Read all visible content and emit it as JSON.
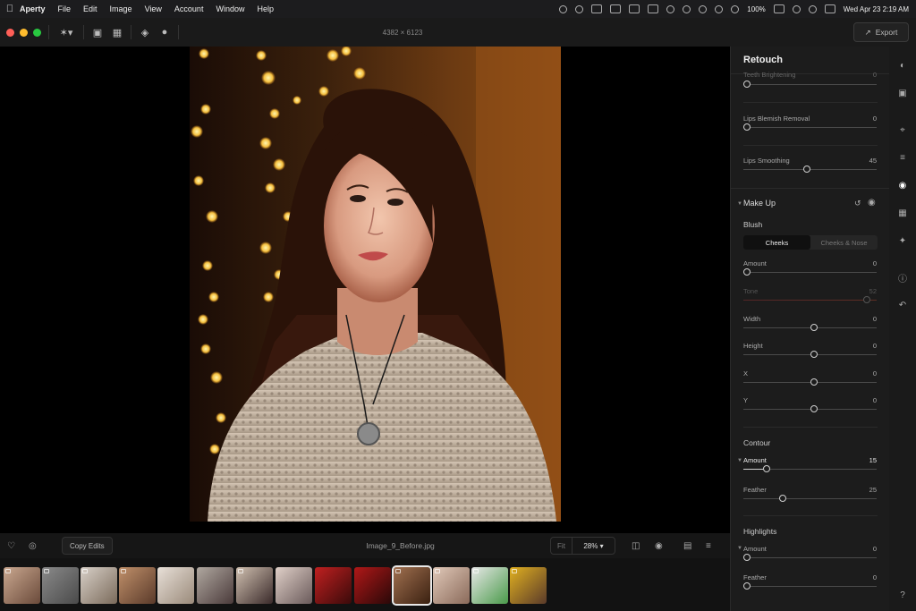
{
  "menubar": {
    "app": "Aperty",
    "items": [
      "File",
      "Edit",
      "Image",
      "View",
      "Account",
      "Window",
      "Help"
    ],
    "battery": "100%",
    "datetime": "Wed Apr 23  2:19 AM"
  },
  "toolbar": {
    "dimensions": "4382 × 6123",
    "export_label": "Export"
  },
  "panel": {
    "title": "Retouch",
    "sliders_top": [
      {
        "label": "Teeth Brightening",
        "value": "0",
        "level": 0
      },
      {
        "label": "Lips Blemish Removal",
        "value": "0",
        "level": 0
      },
      {
        "label": "Lips Smoothing",
        "value": "45",
        "level": 0.45
      }
    ],
    "makeup": {
      "title": "Make Up",
      "blush": {
        "title": "Blush",
        "tabs": [
          "Cheeks",
          "Cheeks & Nose"
        ],
        "sliders": [
          {
            "label": "Amount",
            "value": "0",
            "level": 0
          },
          {
            "label": "Tone",
            "value": "52",
            "level": 0.9
          },
          {
            "label": "Width",
            "value": "0",
            "level": 0.5
          },
          {
            "label": "Height",
            "value": "0",
            "level": 0.5
          },
          {
            "label": "X",
            "value": "0",
            "level": 0.5
          },
          {
            "label": "Y",
            "value": "0",
            "level": 0.5
          }
        ]
      },
      "contour": {
        "title": "Contour",
        "sliders": [
          {
            "label": "Amount",
            "value": "15",
            "level": 0.15
          },
          {
            "label": "Feather",
            "value": "25",
            "level": 0.27
          }
        ]
      },
      "highlights": {
        "title": "Highlights",
        "sliders": [
          {
            "label": "Amount",
            "value": "0",
            "level": 0
          },
          {
            "label": "Feather",
            "value": "0",
            "level": 0
          }
        ]
      }
    }
  },
  "bottom": {
    "copy_edits": "Copy Edits",
    "filename": "Image_9_Before.jpg",
    "fit": "Fit",
    "zoom": "28%"
  }
}
